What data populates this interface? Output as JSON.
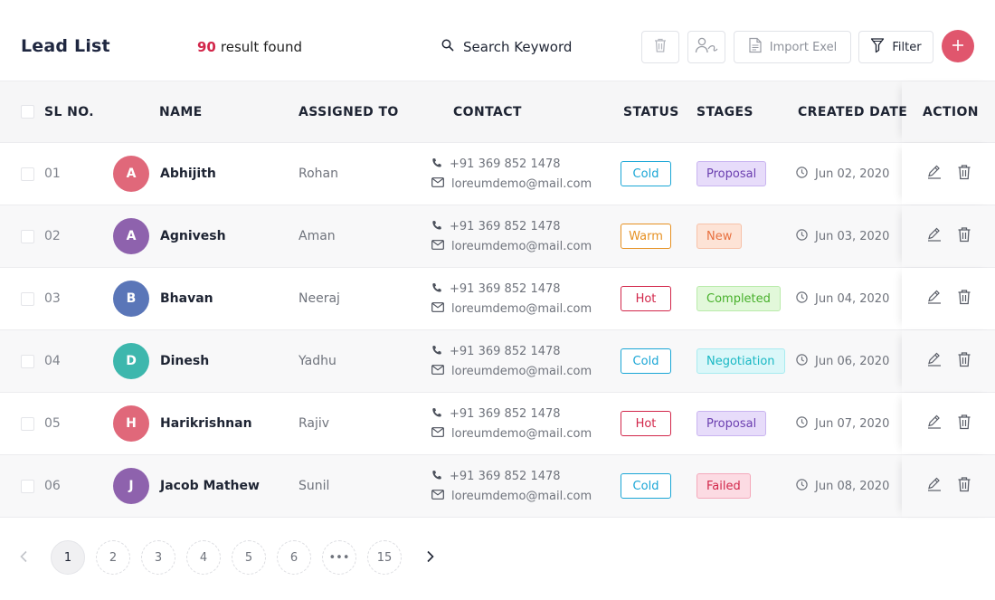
{
  "header": {
    "title": "Lead List",
    "result_count": "90",
    "result_text": "result found",
    "search_label": "Search Keyword",
    "import_label": "Import Exel",
    "filter_label": "Filter"
  },
  "columns": {
    "sl": "SL NO.",
    "name": "NAME",
    "assigned": "ASSIGNED TO",
    "contact": "CONTACT",
    "status": "STATUS",
    "stages": "STAGES",
    "created": "CREATED DATE",
    "action": "ACTION"
  },
  "rows": [
    {
      "sl": "01",
      "initial": "A",
      "avatar_color": "#e0687a",
      "name": "Abhijith",
      "assigned": "Rohan",
      "phone": "+91 369 852 1478",
      "email": "loreumdemo@mail.com",
      "status": "Cold",
      "stage": "Proposal",
      "date": "Jun 02, 2020"
    },
    {
      "sl": "02",
      "initial": "A",
      "avatar_color": "#8e62ad",
      "name": "Agnivesh",
      "assigned": "Aman",
      "phone": "+91 369 852 1478",
      "email": "loreumdemo@mail.com",
      "status": "Warm",
      "stage": "New",
      "date": "Jun 03, 2020"
    },
    {
      "sl": "03",
      "initial": "B",
      "avatar_color": "#5a76b8",
      "name": "Bhavan",
      "assigned": "Neeraj",
      "phone": "+91 369 852 1478",
      "email": "loreumdemo@mail.com",
      "status": "Hot",
      "stage": "Completed",
      "date": "Jun 04, 2020"
    },
    {
      "sl": "04",
      "initial": "D",
      "avatar_color": "#3db7ad",
      "name": "Dinesh",
      "assigned": "Yadhu",
      "phone": "+91 369 852 1478",
      "email": "loreumdemo@mail.com",
      "status": "Cold",
      "stage": "Negotiation",
      "date": "Jun 06, 2020"
    },
    {
      "sl": "05",
      "initial": "H",
      "avatar_color": "#e0687a",
      "name": "Harikrishnan",
      "assigned": "Rajiv",
      "phone": "+91 369 852 1478",
      "email": "loreumdemo@mail.com",
      "status": "Hot",
      "stage": "Proposal",
      "date": "Jun 07, 2020"
    },
    {
      "sl": "06",
      "initial": "J",
      "avatar_color": "#8e62ad",
      "name": "Jacob Mathew",
      "assigned": "Sunil",
      "phone": "+91 369 852 1478",
      "email": "loreumdemo@mail.com",
      "status": "Cold",
      "stage": "Failed",
      "date": "Jun 08, 2020"
    }
  ],
  "status_colors": {
    "Cold": {
      "text": "#1aa6d6",
      "border": "#1aa6d6"
    },
    "Warm": {
      "text": "#e69021",
      "border": "#e69021"
    },
    "Hot": {
      "text": "#d2264a",
      "border": "#d2264a"
    }
  },
  "stage_colors": {
    "Proposal": {
      "text": "#6b3fb0",
      "bg": "#e7dcfa",
      "border": "#c9b4f0"
    },
    "New": {
      "text": "#e8703f",
      "bg": "#fde3d6",
      "border": "#f7c2a9"
    },
    "Completed": {
      "text": "#48b02c",
      "bg": "#e2f8da",
      "border": "#b9ebaa"
    },
    "Negotiation": {
      "text": "#19b8c4",
      "bg": "#dbf7f9",
      "border": "#a8ebf0"
    },
    "Failed": {
      "text": "#d2264a",
      "bg": "#fcdbe3",
      "border": "#f4a9bb"
    }
  },
  "pagination": {
    "pages": [
      "1",
      "2",
      "3",
      "4",
      "5",
      "6",
      "•••",
      "15"
    ],
    "active": "1"
  }
}
